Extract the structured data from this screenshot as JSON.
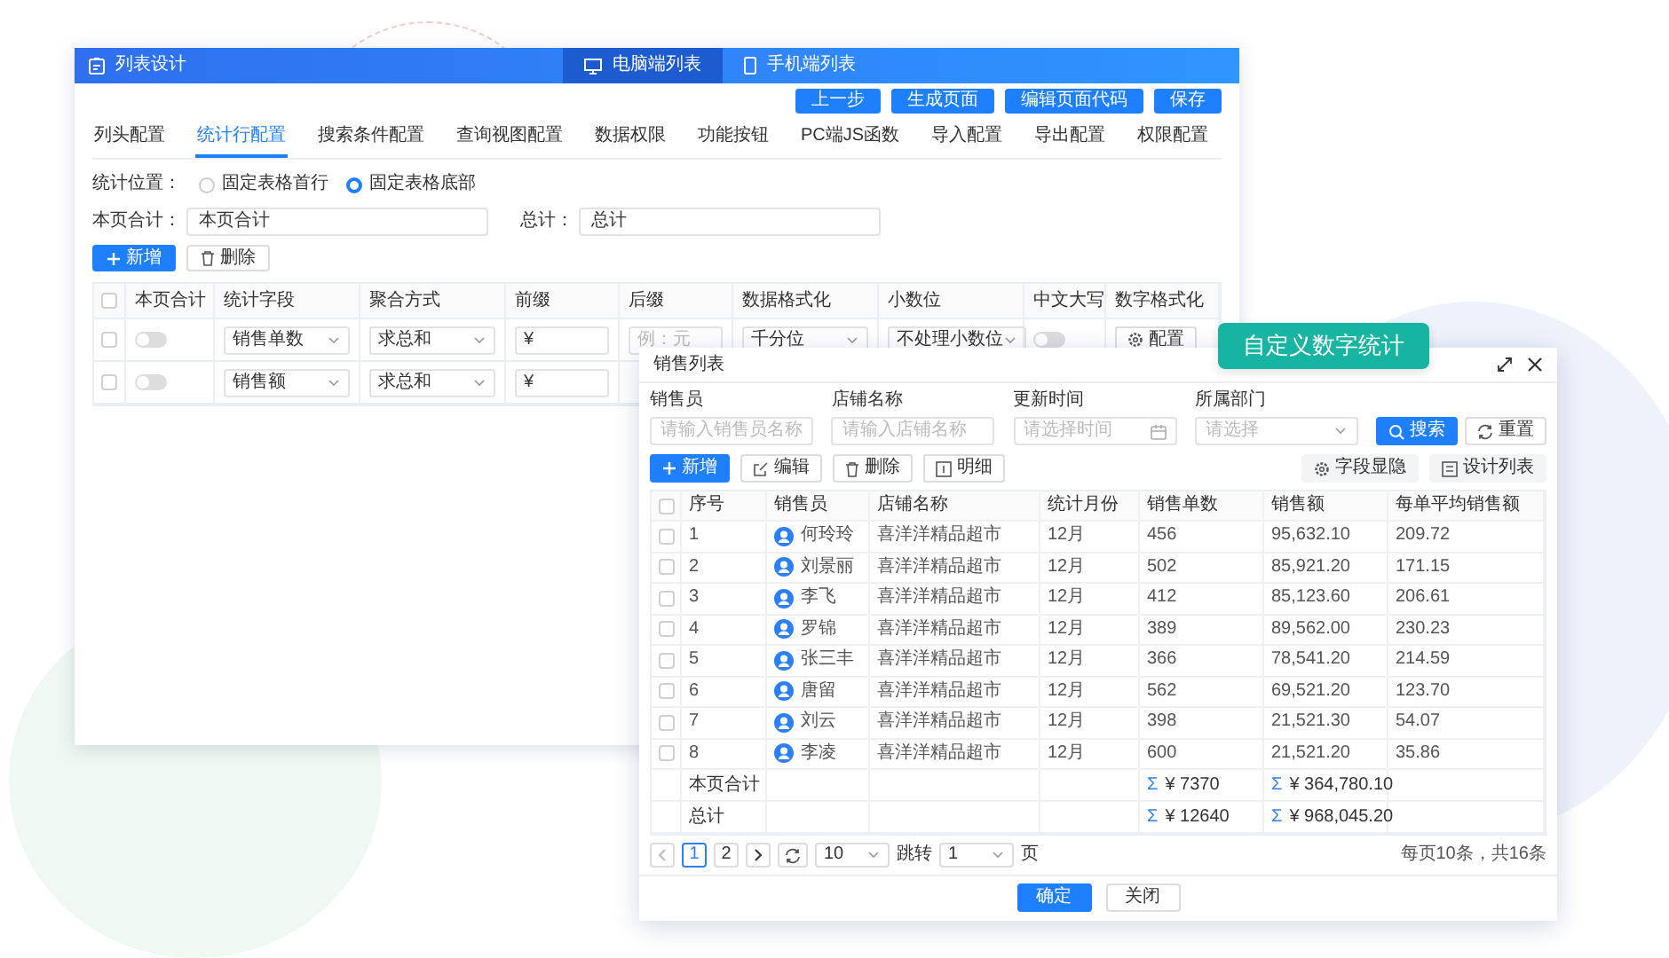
{
  "config_window": {
    "title": "列表设计",
    "view_tabs": [
      {
        "label": "电脑端列表",
        "selected": true,
        "kind": "desktop"
      },
      {
        "label": "手机端列表",
        "selected": false,
        "kind": "mobile"
      }
    ],
    "actions": [
      "上一步",
      "生成页面",
      "编辑页面代码",
      "保存"
    ],
    "tabs": [
      {
        "label": "列头配置",
        "selected": false
      },
      {
        "label": "统计行配置",
        "selected": true
      },
      {
        "label": "搜索条件配置",
        "selected": false
      },
      {
        "label": "查询视图配置",
        "selected": false
      },
      {
        "label": "数据权限",
        "selected": false
      },
      {
        "label": "功能按钮",
        "selected": false
      },
      {
        "label": "PC端JS函数",
        "selected": false
      },
      {
        "label": "导入配置",
        "selected": false
      },
      {
        "label": "导出配置",
        "selected": false
      },
      {
        "label": "权限配置",
        "selected": false
      }
    ],
    "position": {
      "label": "统计位置：",
      "options": [
        {
          "label": "固定表格首行",
          "selected": false
        },
        {
          "label": "固定表格底部",
          "selected": true
        }
      ]
    },
    "fields": [
      {
        "label": "本页合计：",
        "value": "本页合计"
      },
      {
        "label": "总计：",
        "value": "总计"
      }
    ],
    "toolbar": [
      {
        "label": "新增",
        "kind": "add"
      },
      {
        "label": "删除",
        "kind": "delete"
      }
    ],
    "table": {
      "select_all": false,
      "columns": [
        "本页合计",
        "统计字段",
        "聚合方式",
        "前缀",
        "后缀",
        "数据格式化",
        "小数位",
        "中文大写",
        "数字格式化"
      ],
      "rows": [
        {
          "checked": false,
          "cells": [
            {
              "kind": "toggle",
              "on": false
            },
            {
              "kind": "select",
              "value": "销售单数"
            },
            {
              "kind": "select",
              "value": "求总和"
            },
            {
              "kind": "input",
              "value": "¥"
            },
            {
              "kind": "input",
              "placeholder": "例：元"
            },
            {
              "kind": "select",
              "value": "千分位"
            },
            {
              "kind": "select",
              "value": "不处理小数位"
            },
            {
              "kind": "toggle",
              "on": false
            },
            {
              "kind": "button",
              "value": "配置"
            }
          ]
        },
        {
          "checked": false,
          "cells": [
            {
              "kind": "toggle",
              "on": false
            },
            {
              "kind": "select",
              "value": "销售额"
            },
            {
              "kind": "select",
              "value": "求总和"
            },
            {
              "kind": "input",
              "value": "¥"
            }
          ]
        }
      ]
    }
  },
  "badge": "自定义数字统计",
  "dialog": {
    "title": "销售列表",
    "filters": [
      {
        "label": "销售员",
        "placeholder": "请输入销售员名称",
        "kind": "text"
      },
      {
        "label": "店铺名称",
        "placeholder": "请输入店铺名称",
        "kind": "text"
      },
      {
        "label": "更新时间",
        "placeholder": "请选择时间",
        "kind": "date"
      },
      {
        "label": "所属部门",
        "placeholder": "请选择",
        "kind": "select"
      }
    ],
    "filter_buttons": [
      {
        "label": "搜索",
        "kind": "search"
      },
      {
        "label": "重置",
        "kind": "reset"
      }
    ],
    "toolbar": [
      {
        "label": "新增",
        "kind": "add"
      },
      {
        "label": "编辑",
        "kind": "edit"
      },
      {
        "label": "删除",
        "kind": "delete"
      },
      {
        "label": "明细",
        "kind": "detail"
      }
    ],
    "toolbar_right": [
      {
        "label": "字段显隐",
        "kind": "fields"
      },
      {
        "label": "设计列表",
        "kind": "design"
      }
    ],
    "table": {
      "select_all": false,
      "columns": [
        "序号",
        "销售员",
        "店铺名称",
        "统计月份",
        "销售单数",
        "销售额",
        "每单平均销售额"
      ],
      "rows": [
        {
          "checked": false,
          "cells": [
            "1",
            "何玲玲",
            "喜洋洋精品超市",
            "12月",
            "456",
            "95,632.10",
            "209.72"
          ]
        },
        {
          "checked": false,
          "cells": [
            "2",
            "刘景丽",
            "喜洋洋精品超市",
            "12月",
            "502",
            "85,921.20",
            "171.15"
          ]
        },
        {
          "checked": false,
          "cells": [
            "3",
            "李飞",
            "喜洋洋精品超市",
            "12月",
            "412",
            "85,123.60",
            "206.61"
          ]
        },
        {
          "checked": false,
          "cells": [
            "4",
            "罗锦",
            "喜洋洋精品超市",
            "12月",
            "389",
            "89,562.00",
            "230.23"
          ]
        },
        {
          "checked": false,
          "cells": [
            "5",
            "张三丰",
            "喜洋洋精品超市",
            "12月",
            "366",
            "78,541.20",
            "214.59"
          ]
        },
        {
          "checked": false,
          "cells": [
            "6",
            "唐留",
            "喜洋洋精品超市",
            "12月",
            "562",
            "69,521.20",
            "123.70"
          ]
        },
        {
          "checked": false,
          "cells": [
            "7",
            "刘云",
            "喜洋洋精品超市",
            "12月",
            "398",
            "21,521.30",
            "54.07"
          ]
        },
        {
          "checked": false,
          "cells": [
            "8",
            "李凌",
            "喜洋洋精品超市",
            "12月",
            "600",
            "21,521.20",
            "35.86"
          ]
        }
      ],
      "summary": [
        {
          "label": "本页合计",
          "count": {
            "mark": "Σ",
            "value": "¥ 7370"
          },
          "amount": {
            "mark": "Σ",
            "value": "¥ 364,780.10"
          }
        },
        {
          "label": "总计",
          "count": {
            "mark": "Σ",
            "value": "¥ 12640"
          },
          "amount": {
            "mark": "Σ",
            "value": "¥ 968,045.20"
          }
        }
      ]
    },
    "pagination": {
      "pages": [
        {
          "label": "1",
          "selected": true
        },
        {
          "label": "2",
          "selected": false
        }
      ],
      "page_size": "10",
      "jump_label": "跳转",
      "jump_value": "1",
      "page_suffix": "页",
      "summary": "每页10条，共16条"
    },
    "buttons": [
      {
        "label": "确定",
        "kind": "primary"
      },
      {
        "label": "关闭",
        "kind": "default"
      }
    ]
  }
}
